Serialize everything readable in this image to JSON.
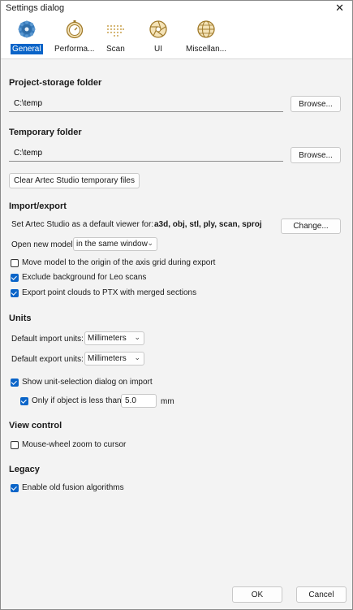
{
  "window": {
    "title": "Settings dialog",
    "close_glyph": "✕"
  },
  "toolbar": {
    "tabs": [
      {
        "label": "General",
        "icon": "gear-icon",
        "active": true
      },
      {
        "label": "Performa...",
        "icon": "stopwatch-icon",
        "active": false
      },
      {
        "label": "Scan",
        "icon": "dot-grid-icon",
        "active": false
      },
      {
        "label": "UI",
        "icon": "aperture-icon",
        "active": false
      },
      {
        "label": "Miscellan...",
        "icon": "globe-icon",
        "active": false
      }
    ]
  },
  "project_storage": {
    "title": "Project-storage folder",
    "path": "C:\\temp",
    "browse_label": "Browse..."
  },
  "temporary": {
    "title": "Temporary folder",
    "path": "C:\\temp",
    "browse_label": "Browse...",
    "clear_label": "Clear Artec Studio temporary files"
  },
  "import_export": {
    "title": "Import/export",
    "default_viewer_label": "Set Artec Studio as a default viewer for:",
    "extensions": "a3d, obj, stl, ply, scan, sproj",
    "change_label": "Change...",
    "open_model_label": "Open new model:",
    "open_model_value": "in the same window",
    "options": [
      {
        "label": "Move model to the origin of the axis grid during export",
        "checked": false
      },
      {
        "label": "Exclude background for Leo scans",
        "checked": true
      },
      {
        "label": "Export point clouds to PTX with merged sections",
        "checked": true
      }
    ]
  },
  "units": {
    "title": "Units",
    "import_label": "Default import units:",
    "import_value": "Millimeters",
    "export_label": "Default export units:",
    "export_value": "Millimeters",
    "show_dialog_label": "Show unit-selection dialog on import",
    "show_dialog_checked": true,
    "only_if_label": "Only if object is less than",
    "only_if_checked": true,
    "threshold_value": "5.0",
    "threshold_unit": "mm"
  },
  "view_control": {
    "title": "View control",
    "zoom_label": "Mouse-wheel zoom to cursor",
    "zoom_checked": false
  },
  "legacy": {
    "title": "Legacy",
    "fusion_label": "Enable old fusion algorithms",
    "fusion_checked": true
  },
  "footer": {
    "ok_label": "OK",
    "cancel_label": "Cancel"
  },
  "colors": {
    "accent": "#0a64c8",
    "background": "#f3f3f3"
  }
}
